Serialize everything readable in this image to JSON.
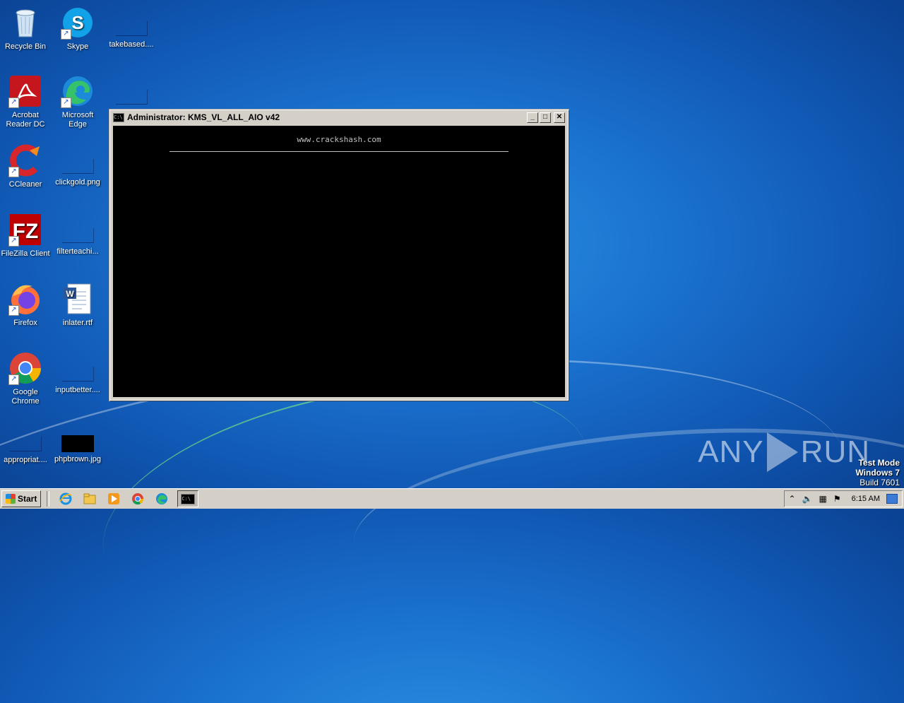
{
  "desktop": {
    "icons": [
      {
        "label": "Recycle Bin",
        "icon": "recycle-bin-icon"
      },
      {
        "label": "Skype",
        "icon": "skype-icon"
      },
      {
        "label": "takebased....",
        "icon": "blank-file-icon"
      },
      {
        "label": "Acrobat Reader DC",
        "icon": "acrobat-icon"
      },
      {
        "label": "Microsoft Edge",
        "icon": "edge-icon"
      },
      {
        "label": "CCleaner",
        "icon": "ccleaner-icon"
      },
      {
        "label": "clickgold.png",
        "icon": "blank-file-icon"
      },
      {
        "label": "FileZilla Client",
        "icon": "filezilla-icon"
      },
      {
        "label": "filterteachi...",
        "icon": "blank-file-icon"
      },
      {
        "label": "Firefox",
        "icon": "firefox-icon"
      },
      {
        "label": "inlater.rtf",
        "icon": "word-document-icon"
      },
      {
        "label": "Google Chrome",
        "icon": "chrome-icon"
      },
      {
        "label": "inputbetter....",
        "icon": "blank-file-icon"
      },
      {
        "label": "appropriat....",
        "icon": "blank-file-icon"
      },
      {
        "label": "phpbrown.jpg",
        "icon": "black-image-icon"
      }
    ]
  },
  "window": {
    "title": "Administrator:  KMS_VL_ALL_AIO v42",
    "console_text": "www.crackshash.com",
    "buttons": {
      "minimize": "_",
      "maximize": "□",
      "close": "✕"
    }
  },
  "watermark": {
    "brand_left": "ANY",
    "brand_right": "RUN",
    "line1": "Test Mode",
    "line2": "Windows 7",
    "line3": "Build 7601"
  },
  "taskbar": {
    "start_label": "Start",
    "pinned": [
      "internet-explorer-icon",
      "folder-icon",
      "media-player-icon",
      "chrome-icon",
      "edge-icon",
      "cmd-icon"
    ],
    "clock": "6:15 AM"
  }
}
